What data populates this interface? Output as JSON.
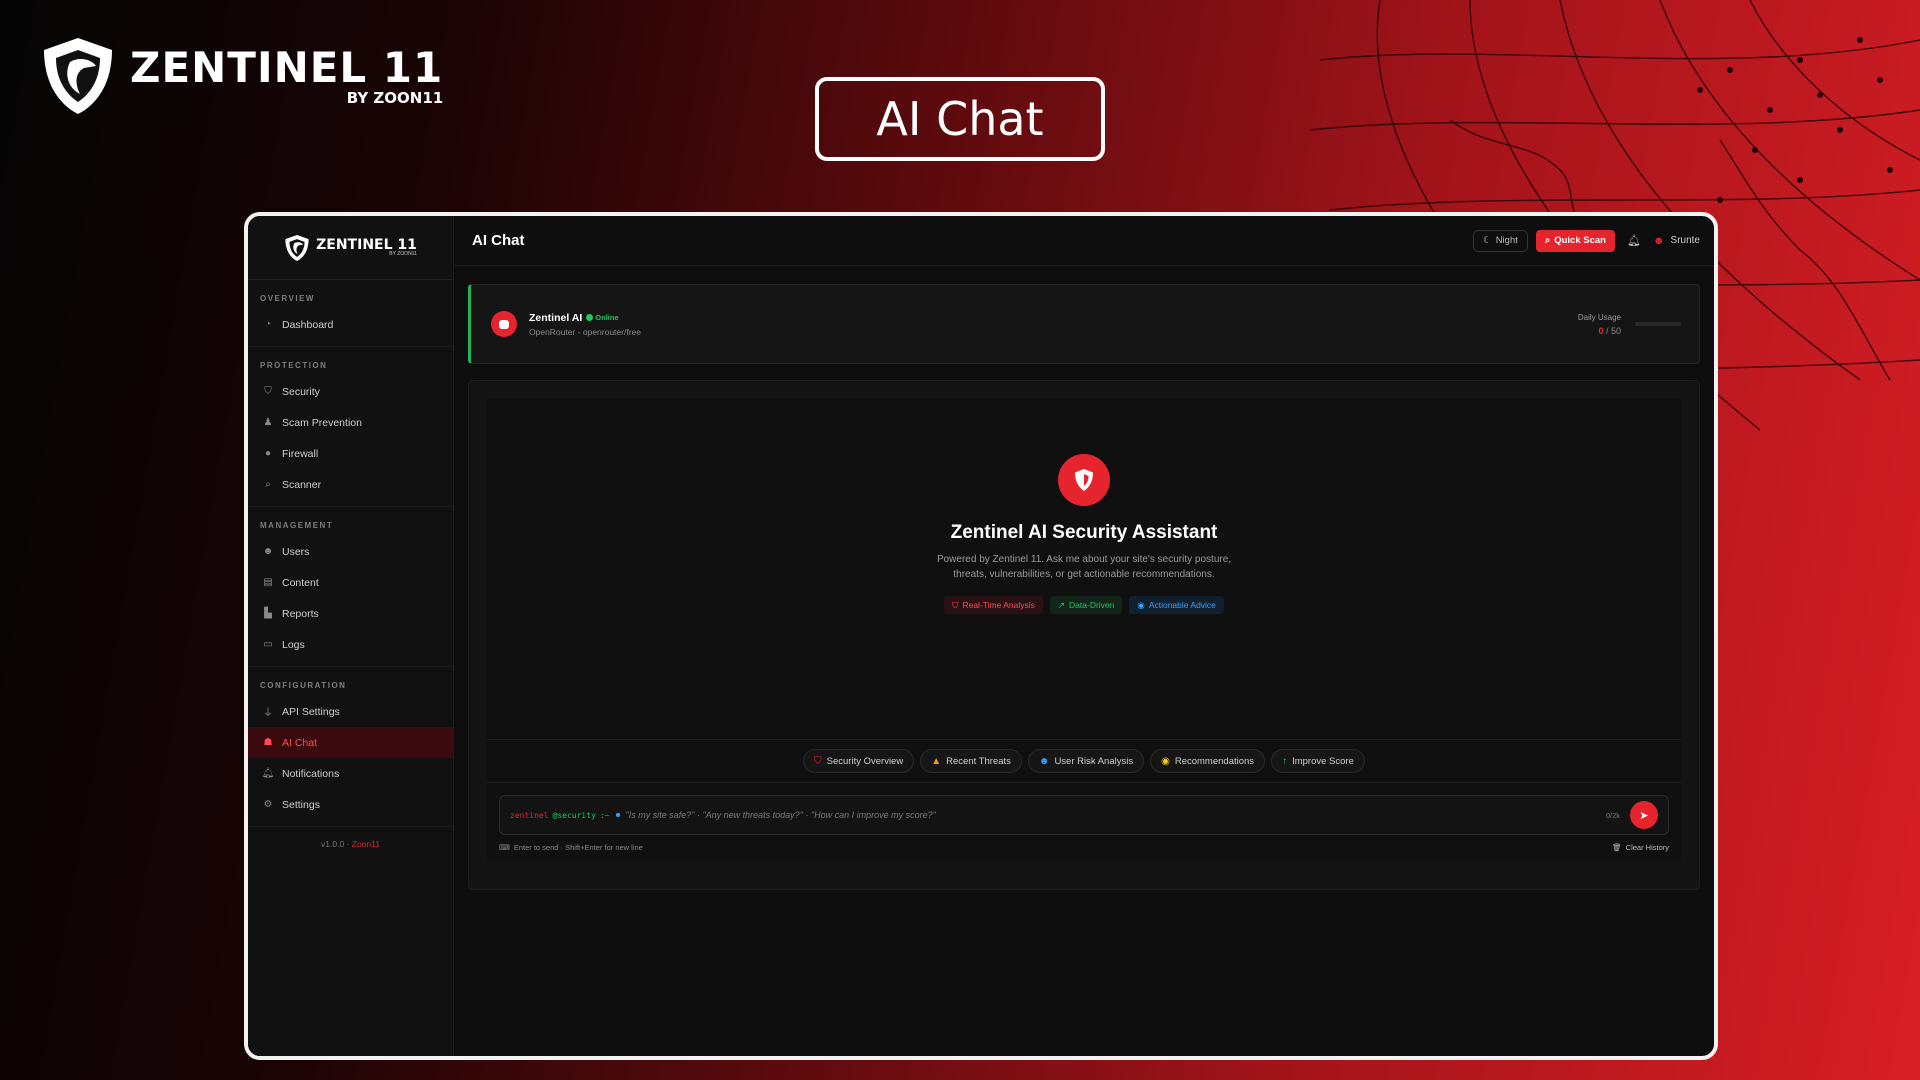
{
  "brand": {
    "name": "ZENTINEL 11",
    "by": "BY ZOON11"
  },
  "page_heading": "AI Chat",
  "sidebar": {
    "logo_name": "ZENTINEL 11",
    "logo_by": "BY ZOON11",
    "sections": [
      {
        "title": "OVERVIEW",
        "items": [
          {
            "label": "Dashboard",
            "icon": "dashboard-icon"
          }
        ]
      },
      {
        "title": "PROTECTION",
        "items": [
          {
            "label": "Security",
            "icon": "shield-icon"
          },
          {
            "label": "Scam Prevention",
            "icon": "user-secret-icon"
          },
          {
            "label": "Firewall",
            "icon": "fire-icon"
          },
          {
            "label": "Scanner",
            "icon": "search-icon"
          }
        ]
      },
      {
        "title": "MANAGEMENT",
        "items": [
          {
            "label": "Users",
            "icon": "users-icon"
          },
          {
            "label": "Content",
            "icon": "file-icon"
          },
          {
            "label": "Reports",
            "icon": "chart-icon"
          },
          {
            "label": "Logs",
            "icon": "list-icon"
          }
        ]
      },
      {
        "title": "CONFIGURATION",
        "items": [
          {
            "label": "API Settings",
            "icon": "plug-icon"
          },
          {
            "label": "AI Chat",
            "icon": "robot-icon",
            "active": true
          },
          {
            "label": "Notifications",
            "icon": "bell-icon"
          },
          {
            "label": "Settings",
            "icon": "gear-icon"
          }
        ]
      }
    ],
    "version": "v1.0.0 ·",
    "version_author": "Zoon11"
  },
  "topbar": {
    "title": "AI Chat",
    "night_label": "Night",
    "quick_scan_label": "Quick Scan",
    "user_name": "Srunte"
  },
  "status": {
    "name": "Zentinel AI",
    "online_label": "Online",
    "provider": "OpenRouter - openrouter/free",
    "usage_label": "Daily Usage",
    "usage_used": "0",
    "usage_limit": "/ 50",
    "usage_fraction": 0
  },
  "hero": {
    "title": "Zentinel AI Security Assistant",
    "description": "Powered by Zentinel 11. Ask me about your site's security posture, threats, vulnerabilities, or get actionable recommendations.",
    "badges": [
      "Real-Time Analysis",
      "Data-Driven",
      "Actionable Advice"
    ]
  },
  "quick_actions": [
    "Security Overview",
    "Recent Threats",
    "User Risk Analysis",
    "Recommendations",
    "Improve Score"
  ],
  "input": {
    "prompt_user": "zentinel",
    "prompt_host": "@security",
    "prompt_sep": ":~",
    "placeholder": "\"Is my site safe?\" · \"Any new threats today?\" · \"How can I improve my score?\"",
    "counter": "0/2k",
    "hint": "Enter to send · Shift+Enter for new line",
    "clear_label": "Clear History"
  },
  "colors": {
    "accent": "#e5242e",
    "online": "#22c55e",
    "info": "#3ba1ff"
  }
}
